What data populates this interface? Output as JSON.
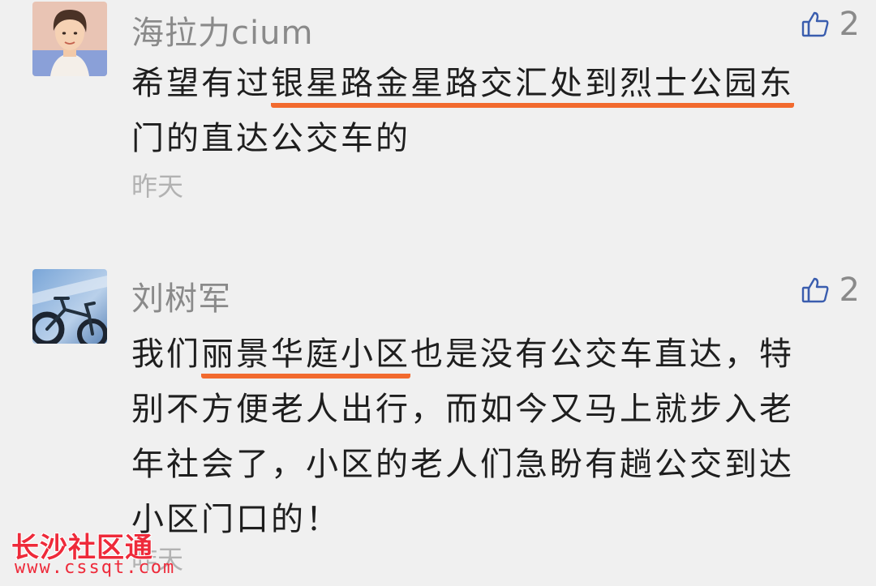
{
  "comments": [
    {
      "username": "海拉力cium",
      "avatar": "portrait-avatar",
      "likes": "2",
      "content": {
        "line1_before": "希望有过",
        "line1_highlight": "银星路金星路交汇处到烈士公园东",
        "line2": "门的直达公交车的"
      },
      "timestamp": "昨天"
    },
    {
      "username": "刘树军",
      "avatar": "bicycle-avatar",
      "likes": "2",
      "content": {
        "line1_before": "我们",
        "line1_highlight": "丽景华庭小区",
        "line1_after": "也是没有公交车直达，特",
        "line2": "别不方便老人出行，而如今又马上就步入老",
        "line3": "年社会了，小区的老人们急盼有趟公交到达",
        "line4": "小区门口的！"
      },
      "timestamp": "昨天"
    }
  ],
  "watermark": {
    "title": "长沙社区通",
    "url": "www.cssqt.com"
  },
  "colors": {
    "background": "#f0f0f0",
    "highlight_underline": "#f26a2e",
    "like_icon": "#3a5dae",
    "watermark": "#ee2a3a",
    "meta_text": "#8a8a8a"
  },
  "icons": [
    "thumbs-up-icon"
  ]
}
